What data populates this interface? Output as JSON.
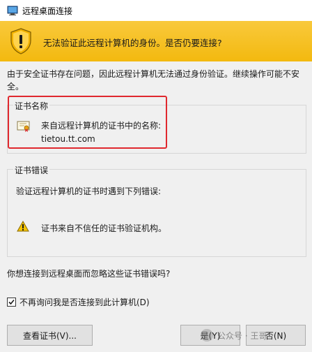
{
  "window": {
    "title": "远程桌面连接"
  },
  "banner": {
    "message": "无法验证此远程计算机的身份。是否仍要连接?"
  },
  "intro": {
    "text": "由于安全证书存在问题，因此远程计算机无法通过身份验证。继续操作可能不安全。"
  },
  "cert_name_group": {
    "label": "证书名称",
    "line": "来自远程计算机的证书中的名称:",
    "host": "tietou.tt.com"
  },
  "cert_error_group": {
    "label": "证书错误",
    "description": "验证远程计算机的证书时遇到下列错误:",
    "error_item": "证书来自不信任的证书验证机构。"
  },
  "question": "你想连接到远程桌面而忽略这些证书错误吗?",
  "dont_ask": {
    "label": "不再询问我是否连接到此计算机(D)",
    "checked": true
  },
  "buttons": {
    "view_cert": "查看证书(V)...",
    "yes": "是(Y)",
    "no": "否(N)"
  },
  "watermark": {
    "text": "公众号 · 王哥"
  },
  "colors": {
    "banner": "#f5bd1a",
    "highlight": "#e0282e",
    "shield_yellow": "#f2b200"
  }
}
